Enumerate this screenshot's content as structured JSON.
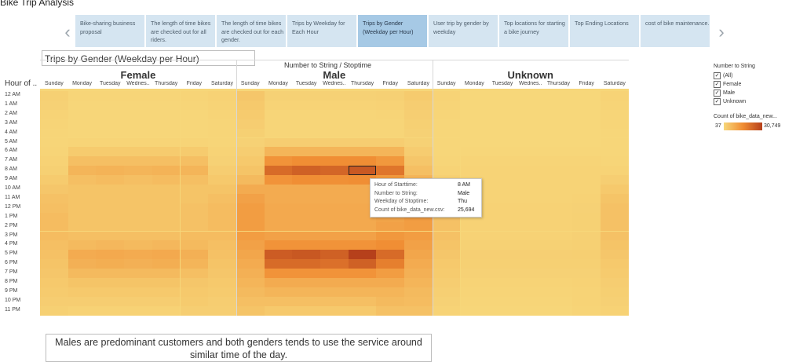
{
  "story": {
    "title": "Bike Trip Analysis"
  },
  "nav": {
    "prev_icon": "chevron-left-icon",
    "next_icon": "chevron-right-icon",
    "tabs": [
      {
        "label": "Bike-sharing business proposal",
        "active": false
      },
      {
        "label": "The length of time bikes are checked out for all riders.",
        "active": false
      },
      {
        "label": "The length of time bikes are checked out for each gender.",
        "active": false
      },
      {
        "label": "Trips by Weekday for Each Hour",
        "active": false
      },
      {
        "label": "Trips by Gender (Weekday per Hour)",
        "active": true
      },
      {
        "label": "User trip by gender by weekday",
        "active": false
      },
      {
        "label": "Top locations for starting a bike journey",
        "active": false
      },
      {
        "label": "Top Ending Locations",
        "active": false
      },
      {
        "label": "cost of bike maintenance.",
        "active": false
      }
    ]
  },
  "sheet": {
    "title": "Trips by Gender (Weekday per Hour)"
  },
  "chart": {
    "column_caption": "Number to String  /  Stoptime",
    "row_header": "Hour of ..",
    "groups": [
      "Female",
      "Male",
      "Unknown"
    ],
    "days": [
      "Sunday",
      "Monday",
      "Tuesday",
      "Wednes..",
      "Thursday",
      "Friday",
      "Saturday"
    ]
  },
  "chart_data": {
    "type": "heatmap",
    "title": "Trips by Gender (Weekday per Hour)",
    "color_measure": "Count of bike_data_new.csv",
    "color_range": [
      37,
      30749
    ],
    "color_low": "#f7d77a",
    "color_high": "#b6401b",
    "rows": [
      "12 AM",
      "1 AM",
      "2 AM",
      "3 AM",
      "4 AM",
      "5 AM",
      "6 AM",
      "7 AM",
      "8 AM",
      "9 AM",
      "10 AM",
      "11 AM",
      "12 PM",
      "1 PM",
      "2 PM",
      "3 PM",
      "4 PM",
      "5 PM",
      "6 PM",
      "7 PM",
      "8 PM",
      "9 PM",
      "10 PM",
      "11 PM"
    ],
    "groups": [
      "Female",
      "Male",
      "Unknown"
    ],
    "days": [
      "Sunday",
      "Monday",
      "Tuesday",
      "Wednesday",
      "Thursday",
      "Friday",
      "Saturday"
    ],
    "series": [
      {
        "name": "Female",
        "values": [
          [
            1500,
            500,
            500,
            500,
            500,
            600,
            1000
          ],
          [
            1200,
            300,
            300,
            300,
            300,
            400,
            800
          ],
          [
            900,
            200,
            200,
            200,
            200,
            300,
            700
          ],
          [
            600,
            150,
            150,
            150,
            150,
            200,
            500
          ],
          [
            500,
            200,
            200,
            200,
            200,
            200,
            400
          ],
          [
            500,
            700,
            700,
            700,
            700,
            700,
            500
          ],
          [
            700,
            2500,
            2500,
            2500,
            2500,
            2500,
            800
          ],
          [
            1000,
            5000,
            5000,
            5000,
            5000,
            5000,
            1200
          ],
          [
            1500,
            7000,
            7500,
            7000,
            7500,
            7000,
            2000
          ],
          [
            2500,
            5000,
            5500,
            5000,
            5500,
            5000,
            3000
          ],
          [
            3500,
            4000,
            4000,
            4000,
            4000,
            4000,
            4000
          ],
          [
            4500,
            4000,
            4000,
            4000,
            4000,
            4000,
            5000
          ],
          [
            5000,
            4000,
            4000,
            4000,
            4000,
            4500,
            5500
          ],
          [
            5500,
            4000,
            4000,
            4000,
            4000,
            4500,
            5500
          ],
          [
            5500,
            4000,
            4000,
            4000,
            4000,
            4500,
            5500
          ],
          [
            5500,
            5000,
            5000,
            5000,
            5000,
            5500,
            5500
          ],
          [
            5000,
            6000,
            6500,
            6000,
            6500,
            6000,
            5000
          ],
          [
            4500,
            9000,
            9500,
            9000,
            9500,
            8000,
            4500
          ],
          [
            4000,
            8000,
            8500,
            8000,
            8500,
            7000,
            4000
          ],
          [
            3500,
            6000,
            6000,
            6000,
            6000,
            5000,
            3500
          ],
          [
            3000,
            4000,
            4000,
            4000,
            4000,
            3500,
            3000
          ],
          [
            2500,
            3000,
            3000,
            3000,
            3000,
            3000,
            2500
          ],
          [
            2000,
            2000,
            2000,
            2000,
            2000,
            2500,
            2000
          ],
          [
            1500,
            1000,
            1000,
            1000,
            1000,
            1800,
            1800
          ]
        ]
      },
      {
        "name": "Male",
        "values": [
          [
            3500,
            1200,
            1200,
            1200,
            1200,
            1400,
            2500
          ],
          [
            3000,
            800,
            800,
            800,
            800,
            1000,
            2000
          ],
          [
            2500,
            500,
            500,
            500,
            500,
            700,
            1800
          ],
          [
            2000,
            400,
            400,
            400,
            400,
            500,
            1500
          ],
          [
            1500,
            500,
            500,
            500,
            500,
            500,
            1200
          ],
          [
            1200,
            2000,
            2000,
            2000,
            2000,
            2000,
            1200
          ],
          [
            2000,
            7000,
            7000,
            7000,
            7000,
            7000,
            2200
          ],
          [
            3000,
            14000,
            15000,
            15000,
            15000,
            13000,
            3500
          ],
          [
            4000,
            22000,
            24000,
            23000,
            25694,
            20000,
            5000
          ],
          [
            6000,
            14000,
            15000,
            14500,
            15000,
            13000,
            7000
          ],
          [
            9000,
            9000,
            9000,
            9000,
            9000,
            9000,
            9000
          ],
          [
            11000,
            9000,
            9000,
            9000,
            9000,
            9500,
            11000
          ],
          [
            12000,
            9500,
            9500,
            9500,
            9500,
            10000,
            12000
          ],
          [
            12000,
            9500,
            9500,
            9500,
            9500,
            10500,
            12000
          ],
          [
            12000,
            9500,
            9500,
            9500,
            9500,
            11000,
            12000
          ],
          [
            12000,
            11000,
            11000,
            11000,
            11000,
            13000,
            12000
          ],
          [
            11000,
            14000,
            14000,
            14000,
            14000,
            15000,
            11000
          ],
          [
            10000,
            25000,
            26000,
            24000,
            30749,
            22000,
            10000
          ],
          [
            9000,
            22000,
            22000,
            21000,
            24000,
            18000,
            9000
          ],
          [
            8000,
            14000,
            14000,
            14000,
            14000,
            12000,
            8000
          ],
          [
            7000,
            9000,
            9000,
            9000,
            9000,
            9000,
            7000
          ],
          [
            6000,
            7000,
            7000,
            7000,
            7000,
            7000,
            6000
          ],
          [
            5000,
            5000,
            5000,
            5000,
            5000,
            6000,
            5500
          ],
          [
            4000,
            3000,
            3000,
            3000,
            3000,
            4500,
            4500
          ]
        ]
      },
      {
        "name": "Unknown",
        "values": [
          [
            800,
            100,
            100,
            100,
            100,
            100,
            900
          ],
          [
            600,
            50,
            50,
            50,
            50,
            80,
            700
          ],
          [
            400,
            40,
            40,
            40,
            40,
            60,
            500
          ],
          [
            300,
            37,
            37,
            37,
            37,
            40,
            400
          ],
          [
            200,
            40,
            40,
            40,
            40,
            40,
            300
          ],
          [
            150,
            100,
            100,
            100,
            100,
            100,
            150
          ],
          [
            300,
            300,
            300,
            300,
            300,
            300,
            300
          ],
          [
            500,
            600,
            600,
            600,
            600,
            600,
            500
          ],
          [
            800,
            900,
            900,
            900,
            900,
            900,
            900
          ],
          [
            1500,
            800,
            800,
            800,
            800,
            800,
            1800
          ],
          [
            2500,
            800,
            800,
            800,
            800,
            900,
            3000
          ],
          [
            3500,
            900,
            900,
            900,
            900,
            1000,
            4000
          ],
          [
            4000,
            1000,
            1000,
            1000,
            1000,
            1200,
            4500
          ],
          [
            4500,
            1000,
            1000,
            1000,
            1000,
            1300,
            4500
          ],
          [
            4500,
            1000,
            1000,
            1000,
            1000,
            1300,
            4500
          ],
          [
            4500,
            1100,
            1100,
            1100,
            1100,
            1400,
            4500
          ],
          [
            4000,
            1300,
            1300,
            1300,
            1300,
            1500,
            4000
          ],
          [
            3500,
            1600,
            1600,
            1600,
            1600,
            1700,
            3500
          ],
          [
            3000,
            1500,
            1500,
            1500,
            1500,
            1500,
            3000
          ],
          [
            2500,
            1200,
            1200,
            1200,
            1200,
            1200,
            2500
          ],
          [
            2000,
            900,
            900,
            900,
            900,
            1000,
            2000
          ],
          [
            1600,
            700,
            700,
            700,
            700,
            900,
            1700
          ],
          [
            1200,
            500,
            500,
            500,
            500,
            800,
            1400
          ],
          [
            900,
            300,
            300,
            300,
            300,
            700,
            1100
          ]
        ]
      }
    ]
  },
  "tooltip": {
    "rows": [
      {
        "key": "Hour of Starttime:",
        "value": "8 AM"
      },
      {
        "key": "Number to String:",
        "value": "Male"
      },
      {
        "key": "Weekday of Stoptime:",
        "value": "Thu"
      },
      {
        "key": "Count of bike_data_new.csv:",
        "value": "25,694"
      }
    ]
  },
  "legend": {
    "filter_title": "Number to String",
    "items": [
      {
        "label": "(All)",
        "checked": true
      },
      {
        "label": "Female",
        "checked": true
      },
      {
        "label": "Male",
        "checked": true
      },
      {
        "label": "Unknown",
        "checked": true
      }
    ],
    "color_title": "Count of bike_data_new...",
    "min_label": "37",
    "max_label": "30,749"
  },
  "caption": {
    "text": "Males are  predominant customers and both genders tends to use the service around similar time of the day."
  }
}
